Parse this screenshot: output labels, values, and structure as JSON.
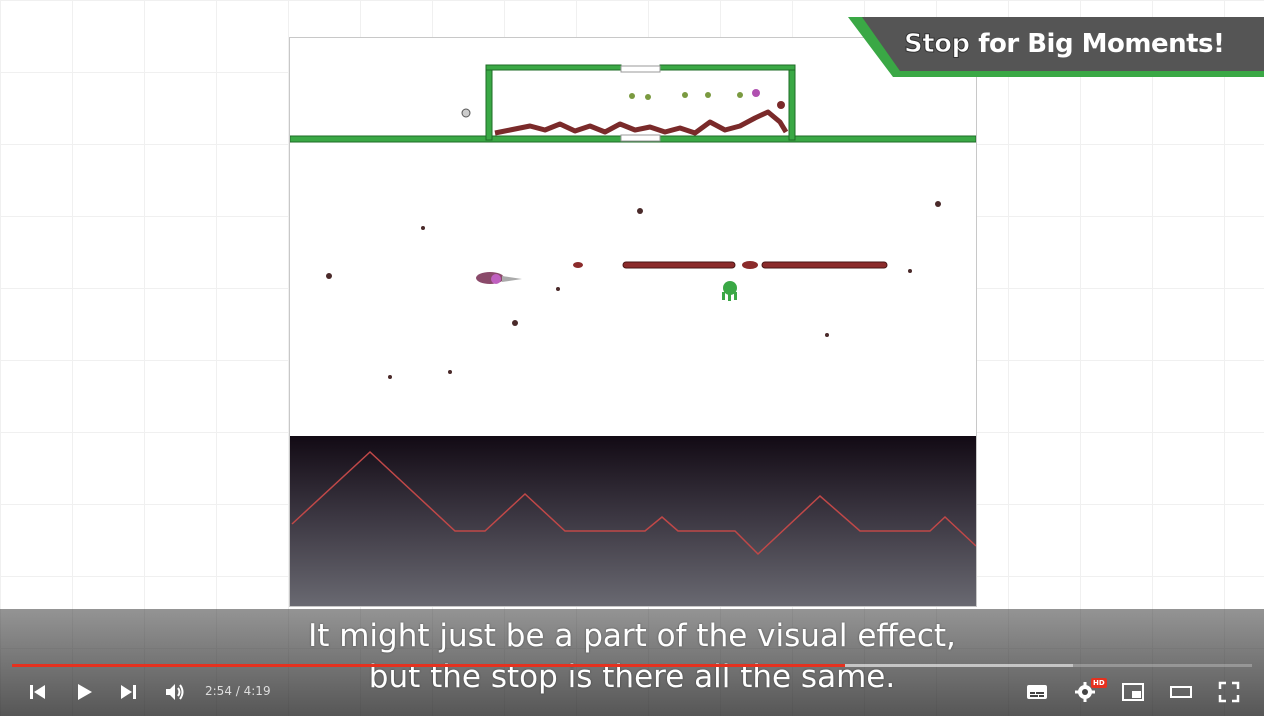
{
  "banner": {
    "stop_word": "Stop",
    "rest_text": " for Big Moments!"
  },
  "caption": {
    "line1": "It might just be a part of the visual effect,",
    "line2": "but the stop is there all the same."
  },
  "player": {
    "current_time": "2:54",
    "separator": " / ",
    "duration": "4:19",
    "played_fraction": 0.672,
    "buffered_fraction": 0.856,
    "hd_badge": "HD"
  },
  "icons": {
    "previous": "skip-previous-icon",
    "play": "play-icon",
    "next": "skip-next-icon",
    "volume": "volume-icon",
    "subtitles": "subtitles-icon",
    "settings": "gear-icon",
    "miniplayer": "miniplayer-icon",
    "theater": "theater-mode-icon",
    "fullscreen": "fullscreen-icon"
  },
  "colors": {
    "progress_played": "#e5311f",
    "banner_bg": "#555555",
    "banner_accent": "#3aa845",
    "platform_green": "#3aa845",
    "laser": "#8b2b2b",
    "enemy_green": "#3aa845"
  }
}
